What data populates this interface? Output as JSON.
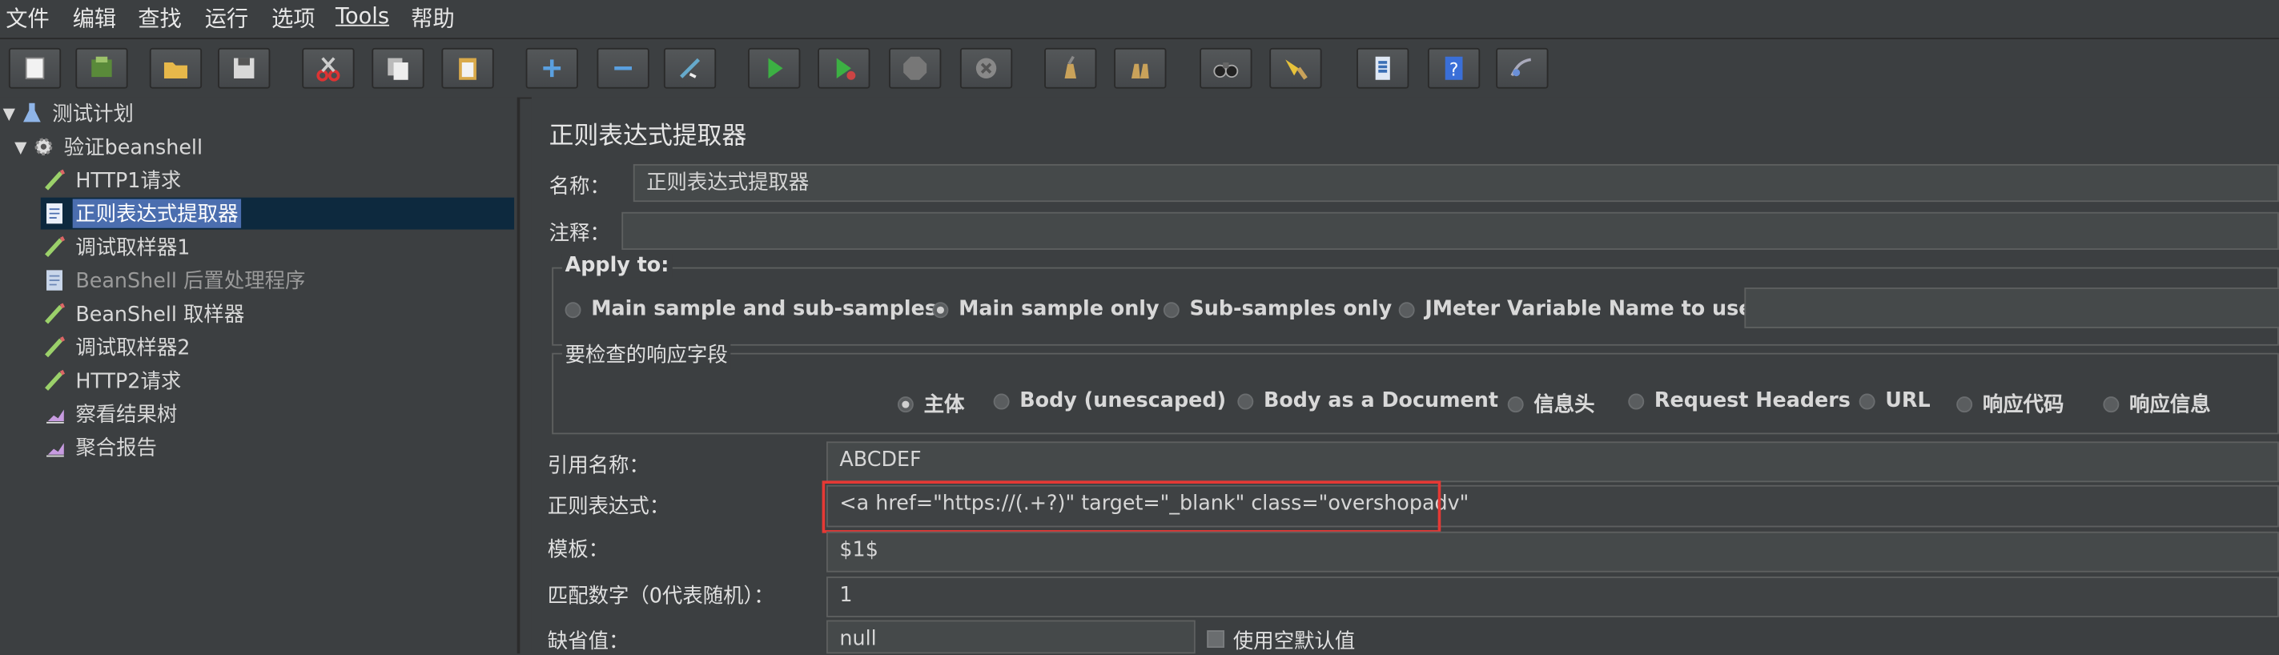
{
  "menu": [
    "文件",
    "编辑",
    "查找",
    "运行",
    "选项",
    "Tools",
    "帮助"
  ],
  "toolbar": {
    "buttons": [
      "new-icon",
      "templates-icon",
      "open-icon",
      "save-icon",
      "cut-icon",
      "copy-icon",
      "paste-icon",
      "expand-icon",
      "collapse-icon",
      "toggle-icon",
      "start-icon",
      "start-no-pause-icon",
      "stop-icon",
      "shutdown-icon",
      "clear-icon",
      "clear-all-icon",
      "search-icon",
      "reset-search-icon",
      "function-helper-icon",
      "help-icon",
      "remote-icon"
    ]
  },
  "tree": {
    "items": [
      {
        "label": "测试计划",
        "icon": "test-plan-icon",
        "level": 0,
        "expanded": true
      },
      {
        "label": "验证beanshell",
        "icon": "thread-group-gear-icon",
        "level": 1,
        "expanded": true
      },
      {
        "label": "HTTP1请求",
        "icon": "sampler-pen-icon",
        "level": 2
      },
      {
        "label": "正则表达式提取器",
        "icon": "extractor-doc-icon",
        "level": 2,
        "selected": true
      },
      {
        "label": "调试取样器1",
        "icon": "sampler-pen-icon",
        "level": 2
      },
      {
        "label": "BeanShell 后置处理程序",
        "icon": "postprocessor-doc-icon",
        "level": 2,
        "disabled": true
      },
      {
        "label": "BeanShell 取样器",
        "icon": "sampler-pen-icon",
        "level": 2
      },
      {
        "label": "调试取样器2",
        "icon": "sampler-pen-icon",
        "level": 2
      },
      {
        "label": "HTTP2请求",
        "icon": "sampler-pen-icon",
        "level": 2
      },
      {
        "label": "察看结果树",
        "icon": "listener-chart-icon",
        "level": 2
      },
      {
        "label": "聚合报告",
        "icon": "listener-chart-icon",
        "level": 2
      }
    ]
  },
  "panel": {
    "title": "正则表达式提取器",
    "name_label": "名称：",
    "name_value": "正则表达式提取器",
    "comment_label": "注释：",
    "comment_value": "",
    "apply_to": {
      "legend": "Apply to:",
      "options": [
        "Main sample and sub-samples",
        "Main sample only",
        "Sub-samples only",
        "JMeter Variable Name to use"
      ],
      "selected": "Main sample only",
      "variable_value": ""
    },
    "field_to_check": {
      "legend": "要检查的响应字段",
      "options": [
        "主体",
        "Body (unescaped)",
        "Body as a Document",
        "信息头",
        "Request Headers",
        "URL",
        "响应代码",
        "响应信息"
      ],
      "selected": "主体"
    },
    "ref_name_label": "引用名称：",
    "ref_name_value": "ABCDEF",
    "regex_label": "正则表达式：",
    "regex_value": "<a href=\"https://(.+?)\" target=\"_blank\" class=\"overshopadv\"",
    "template_label": "模板：",
    "template_value": "$1$",
    "match_no_label": "匹配数字（0代表随机）：",
    "match_no_value": "1",
    "default_label": "缺省值：",
    "default_value": "null",
    "use_empty_default_label": "使用空默认值",
    "use_empty_default_checked": false
  },
  "colors": {
    "background": "#3c3f41",
    "selection": "#4b6eaf",
    "highlight_box": "#e53935"
  }
}
